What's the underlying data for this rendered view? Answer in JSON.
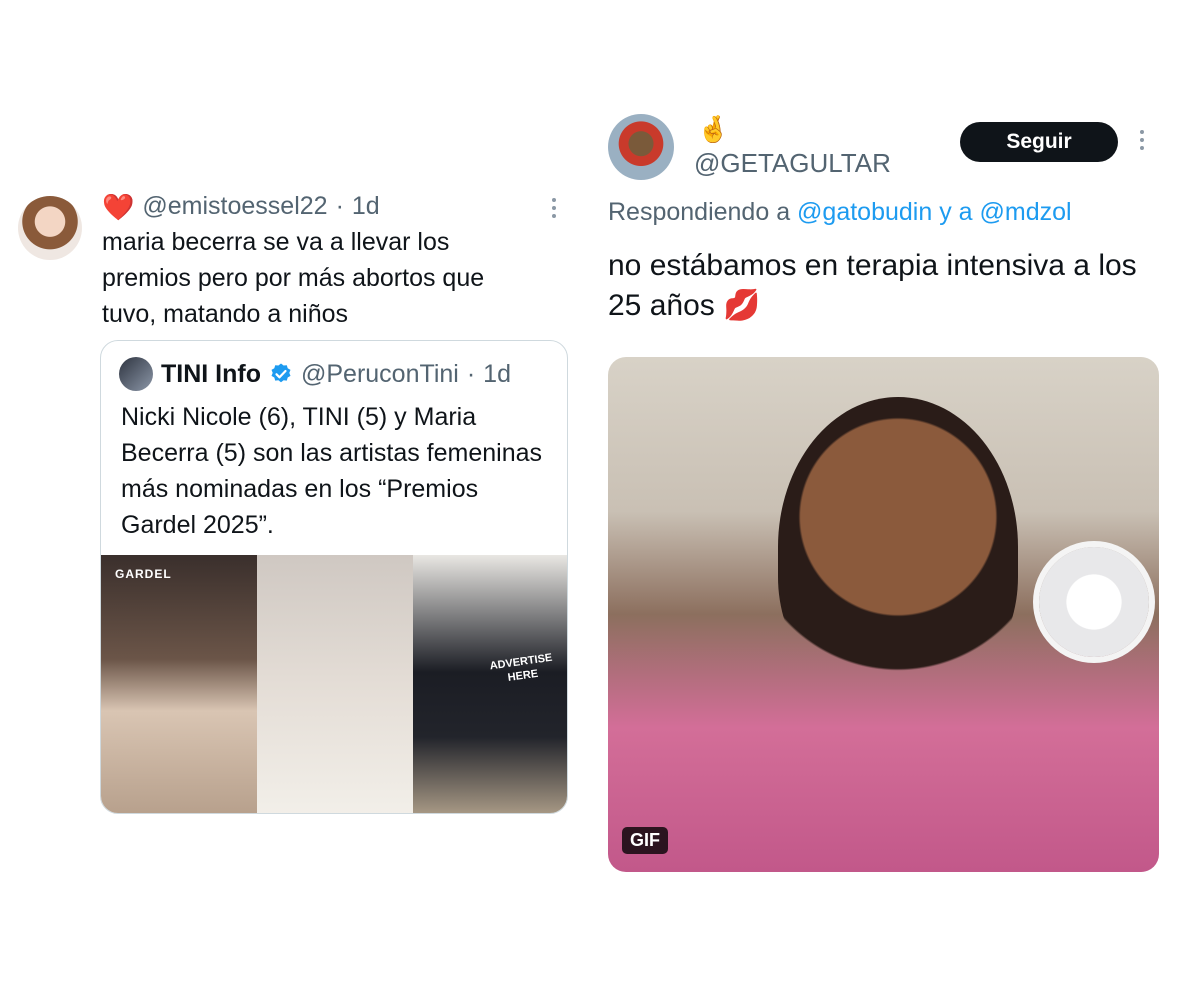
{
  "left_tweet": {
    "heart_emoji": "❤️",
    "handle": "@emistoessel22",
    "separator": "·",
    "time": "1d",
    "body": "maria becerra se va a llevar los premios pero por más abortos que tuvo, matando a niños",
    "quote": {
      "name": "TINI Info",
      "handle": "@PeruconTini",
      "separator": "·",
      "time": "1d",
      "text": "Nicki Nicole (6), TINI (5) y Maria Becerra (5) son las artistas femeninas más nominadas en los “Premios Gardel 2025”.",
      "media_watermark": "GARDEL",
      "shirt_text": "ADVERTISE HERE"
    }
  },
  "right_tweet": {
    "emoji": "🤞",
    "handle": "@GETAGULTAR",
    "follow_label": "Seguir",
    "replying_prefix": "Respondiendo a",
    "replying_user1": "@gatobudin",
    "replying_joiner": "y a",
    "replying_user2": "@mdzol",
    "body": "no estábamos en terapia intensiva a los 25 años 💋",
    "gif_label": "GIF"
  }
}
